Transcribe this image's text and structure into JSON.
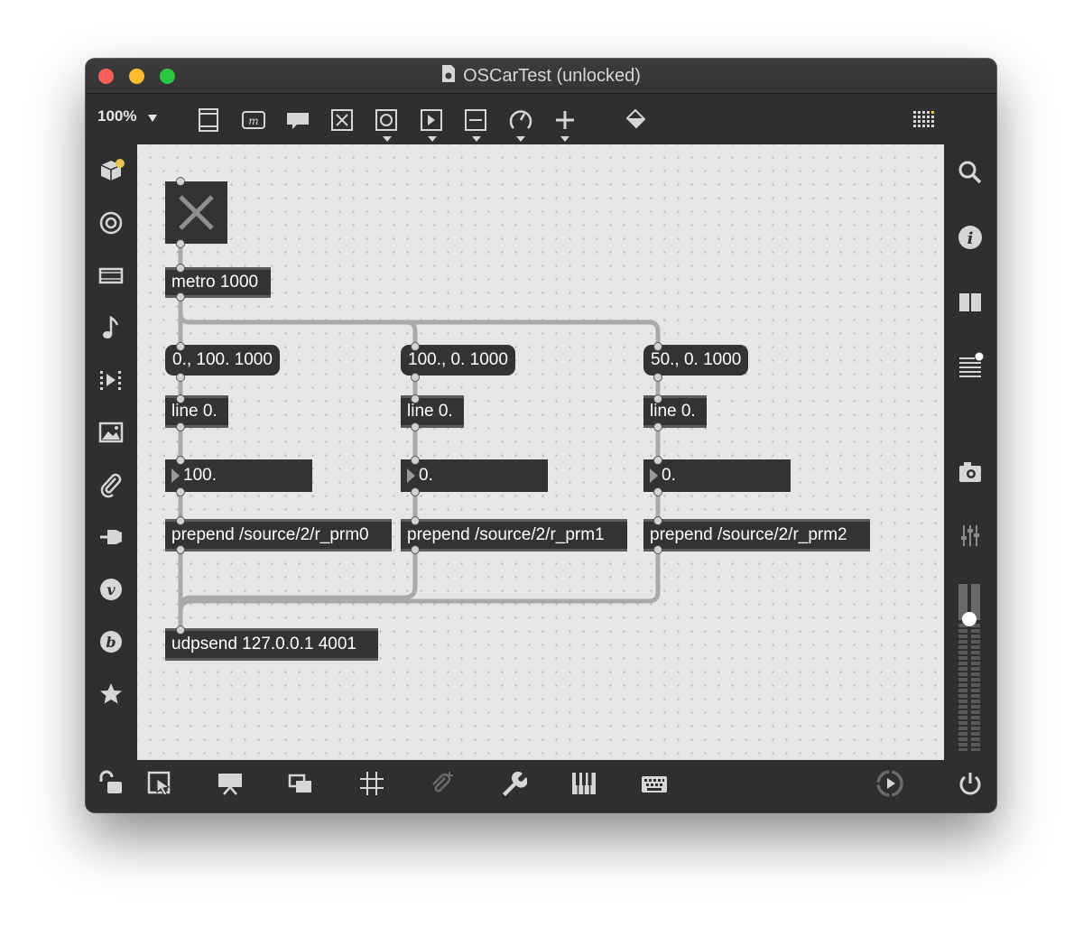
{
  "window": {
    "title": "OSCarTest (unlocked)",
    "traffic_lights": {
      "close": "#fe5f57",
      "minimize": "#febc2e",
      "zoom": "#28c840"
    }
  },
  "toolbar": {
    "zoom_label": "100%",
    "tools": [
      "new-object-icon",
      "message-icon",
      "comment-icon",
      "toggle-icon",
      "button-icon",
      "number-box-icon",
      "slider-icon",
      "dial-icon",
      "plus-icon",
      "paint-bucket-icon",
      "grid-dots-icon"
    ]
  },
  "left_sidebar": [
    "packages-icon",
    "target-icon",
    "film-icon",
    "music-note-icon",
    "step-sequencer-icon",
    "image-icon",
    "paperclip-icon",
    "plug-icon",
    "v-icon",
    "b-icon",
    "star-icon"
  ],
  "right_sidebar": [
    "search-icon",
    "info-icon",
    "book-icon",
    "list-icon",
    "camera-icon",
    "mixer-icon"
  ],
  "patch": {
    "metro": "metro 1000",
    "messages": [
      "0., 100. 1000",
      "100., 0. 1000",
      "50., 0. 1000"
    ],
    "lines": [
      "line 0.",
      "line 0.",
      "line 0."
    ],
    "numbers": [
      "100.",
      "0.",
      "0."
    ],
    "prepends": [
      "prepend /source/2/r_prm0",
      "prepend /source/2/r_prm1",
      "prepend /source/2/r_prm2"
    ],
    "udpsend": "udpsend 127.0.0.1 4001"
  },
  "bottom_toolbar": [
    "lock-icon",
    "presentation-select-icon",
    "presentation-icon",
    "windows-icon",
    "grid-icon",
    "attach-icon",
    "wrench-icon",
    "piano-icon",
    "keyboard-icon",
    "play-icon",
    "power-icon"
  ],
  "audio_level": 0.79
}
